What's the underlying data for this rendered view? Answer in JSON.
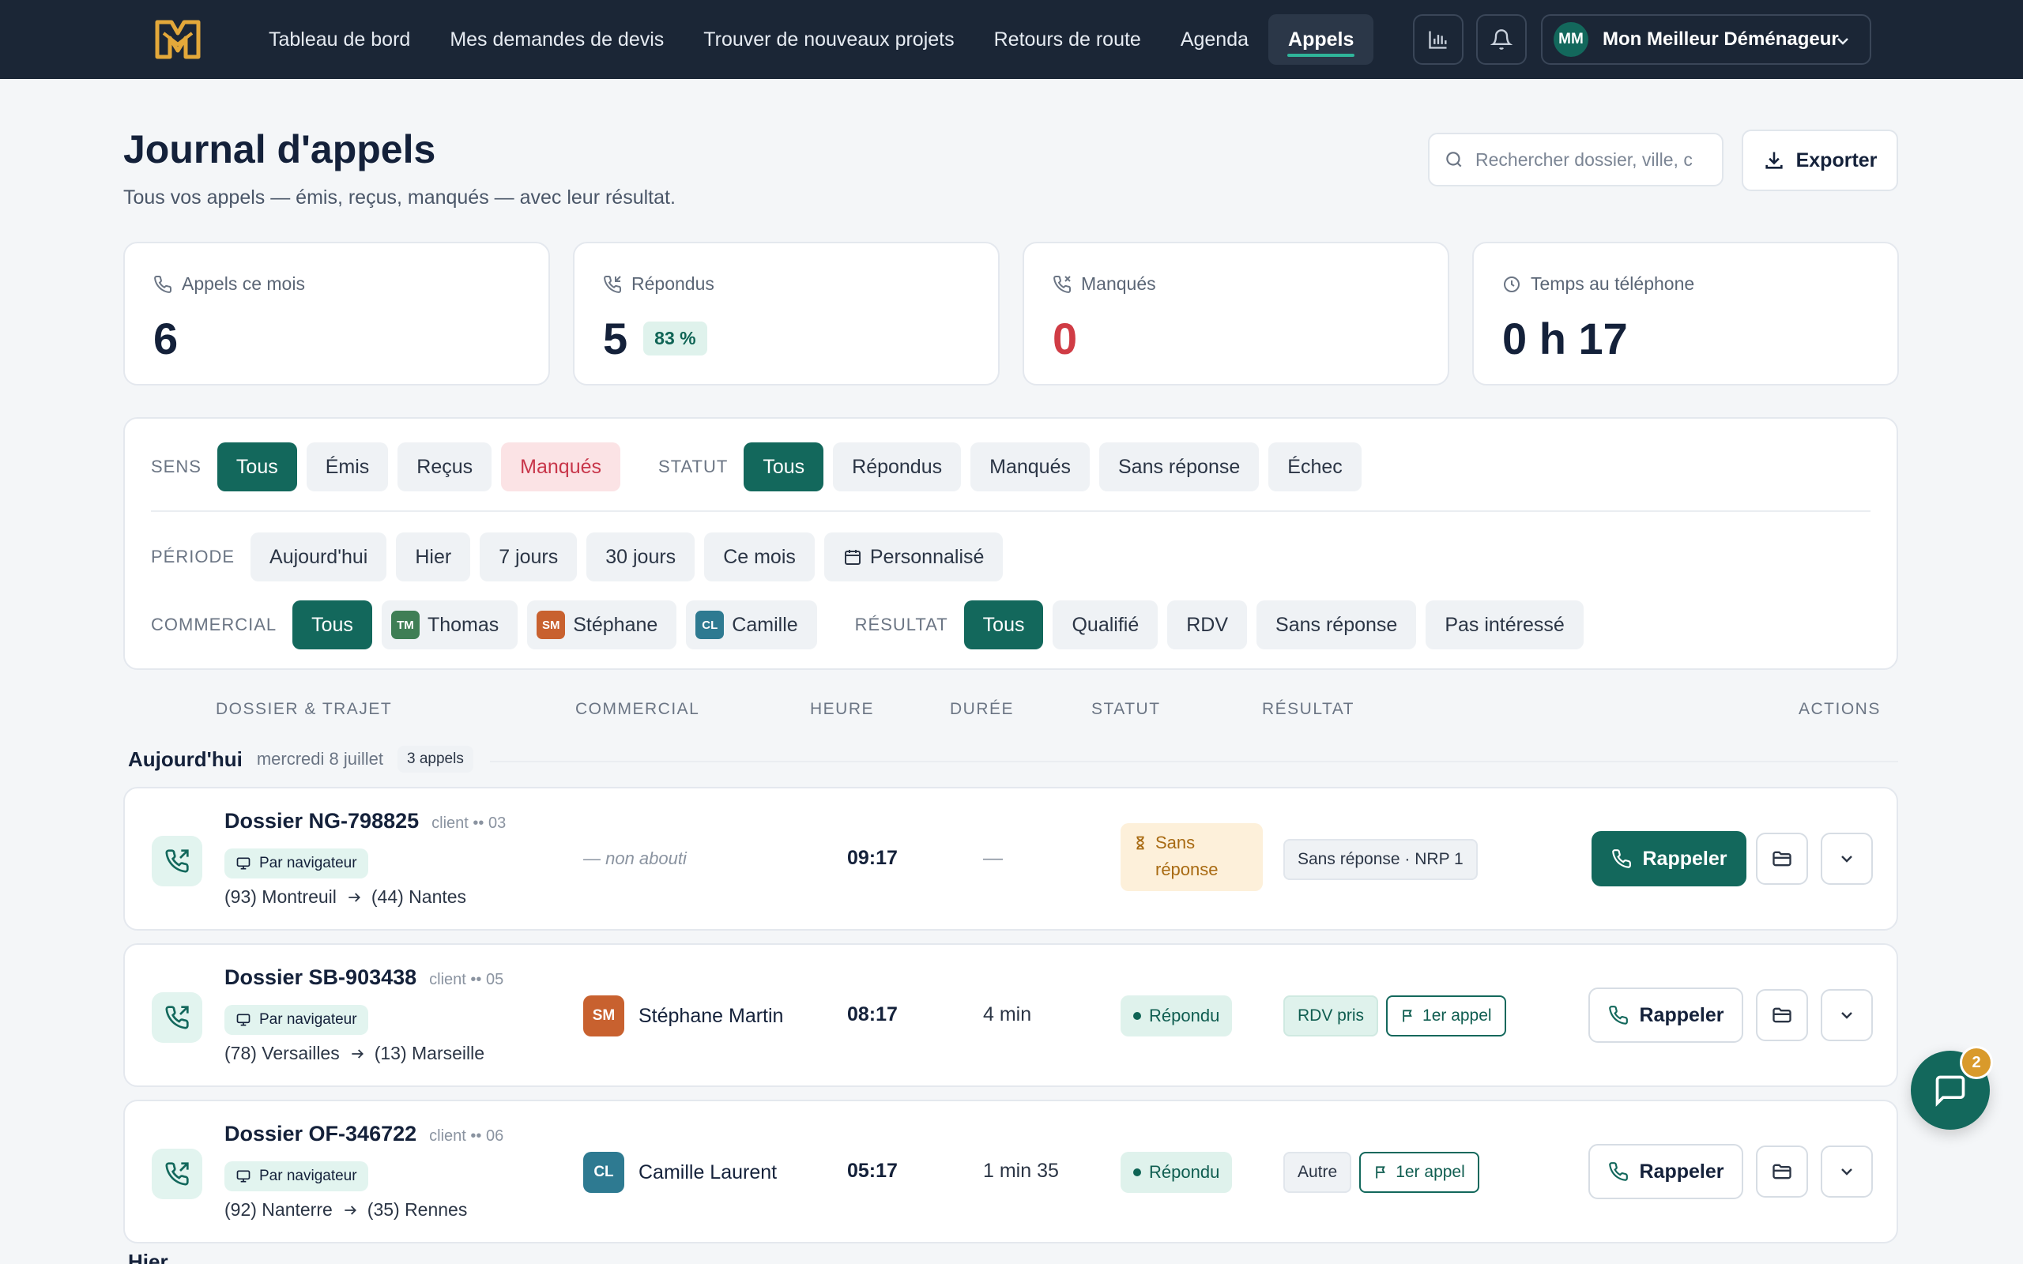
{
  "nav": {
    "items": [
      "Tableau de bord",
      "Mes demandes de devis",
      "Trouver de nouveaux projets",
      "Retours de route",
      "Agenda",
      "Appels"
    ],
    "active_index": 5,
    "user_initials": "MM",
    "user_name": "Mon Meilleur Déménageur"
  },
  "header": {
    "title": "Journal d'appels",
    "subtitle": "Tous vos appels — émis, reçus, manqués — avec leur résultat.",
    "search_placeholder": "Rechercher dossier, ville, c",
    "export_label": "Exporter"
  },
  "stats": [
    {
      "label": "Appels ce mois",
      "value": "6",
      "icon": "phone-icon"
    },
    {
      "label": "Répondus",
      "value": "5",
      "pill": "83 %",
      "icon": "phone-incoming-icon"
    },
    {
      "label": "Manqués",
      "value": "0",
      "icon": "phone-missed-icon"
    },
    {
      "label": "Temps au téléphone",
      "value": "0 h 17",
      "icon": "clock-icon"
    }
  ],
  "filters": {
    "sens": {
      "label": "SENS",
      "options": [
        "Tous",
        "Émis",
        "Reçus",
        "Manqués"
      ],
      "selected": "Tous"
    },
    "statut": {
      "label": "STATUT",
      "options": [
        "Tous",
        "Répondus",
        "Manqués",
        "Sans réponse",
        "Échec"
      ],
      "selected": "Tous"
    },
    "periode": {
      "label": "PÉRIODE",
      "options": [
        "Aujourd'hui",
        "Hier",
        "7 jours",
        "30 jours",
        "Ce mois",
        "Personnalisé"
      ]
    },
    "commercial": {
      "label": "COMMERCIAL",
      "options": [
        {
          "label": "Tous"
        },
        {
          "label": "Thomas",
          "initials": "TM",
          "color": "#3f7e55"
        },
        {
          "label": "Stéphane",
          "initials": "SM",
          "color": "#c8612f"
        },
        {
          "label": "Camille",
          "initials": "CL",
          "color": "#2e7a91"
        }
      ],
      "selected": "Tous"
    },
    "resultat": {
      "label": "RÉSULTAT",
      "options": [
        "Tous",
        "Qualifié",
        "RDV",
        "Sans réponse",
        "Pas intéressé"
      ],
      "selected": "Tous"
    }
  },
  "table": {
    "columns": [
      "DOSSIER & TRAJET",
      "COMMERCIAL",
      "HEURE",
      "DURÉE",
      "STATUT",
      "RÉSULTAT",
      "ACTIONS"
    ]
  },
  "groups": [
    {
      "title": "Aujourd'hui",
      "date": "mercredi 8 juillet",
      "count": "3 appels"
    }
  ],
  "calls": [
    {
      "dossier": "Dossier NG-798825",
      "client": "client •• 03",
      "source": "Par navigateur",
      "from": "(93) Montreuil",
      "to": "(44) Nantes",
      "commercial": "— non abouti",
      "time": "09:17",
      "duration": "—",
      "status": "Sans réponse",
      "status_type": "pending",
      "results": [
        {
          "label": "Sans réponse · NRP 1",
          "style": "gray"
        }
      ],
      "action_label": "Rappeler",
      "action_style": "primary"
    },
    {
      "dossier": "Dossier SB-903438",
      "client": "client •• 05",
      "source": "Par navigateur",
      "from": "(78) Versailles",
      "to": "(13) Marseille",
      "commercial": "Stéphane Martin",
      "commercial_initials": "SM",
      "commercial_color": "#c8612f",
      "time": "08:17",
      "duration": "4 min",
      "status": "Répondu",
      "status_type": "ok",
      "results": [
        {
          "label": "RDV pris",
          "style": "green"
        },
        {
          "label": "1er appel",
          "style": "outline",
          "icon": "flag-icon"
        }
      ],
      "action_label": "Rappeler",
      "action_style": "secondary"
    },
    {
      "dossier": "Dossier OF-346722",
      "client": "client •• 06",
      "source": "Par navigateur",
      "from": "(92) Nanterre",
      "to": "(35) Rennes",
      "commercial": "Camille Laurent",
      "commercial_initials": "CL",
      "commercial_color": "#2e7a91",
      "time": "05:17",
      "duration": "1 min 35",
      "status": "Répondu",
      "status_type": "ok",
      "results": [
        {
          "label": "Autre",
          "style": "gray"
        },
        {
          "label": "1er appel",
          "style": "outline",
          "icon": "flag-icon"
        }
      ],
      "action_label": "Rappeler",
      "action_style": "secondary"
    }
  ],
  "next_group_title": "Hier",
  "chat": {
    "badge": "2"
  },
  "colors": {
    "accent": "#13685c",
    "topbar": "#1b2636",
    "missed": "#d03c45",
    "pending": "#a86a12"
  }
}
